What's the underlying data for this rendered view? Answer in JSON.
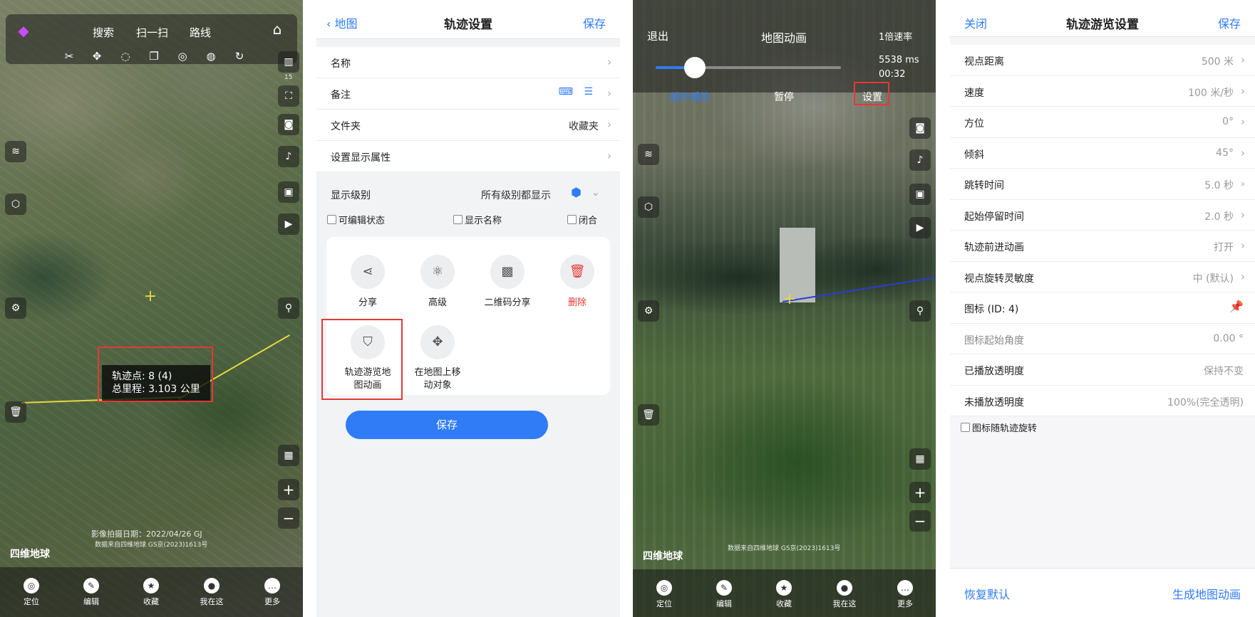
{
  "p1": {
    "top_tabs": [
      "搜索",
      "扫一扫",
      "路线"
    ],
    "level_badge": "15",
    "popup": {
      "line1": "轨迹点: 8 (4)",
      "line2": "总里程: 3.103 公里"
    },
    "capture_date": "影像拍摄日期：2022/04/26 GJ",
    "data_source": "数据来自四维地球 GS京(2023)1613号",
    "logo": "四维地球",
    "bottom_nav": [
      "定位",
      "编辑",
      "收藏",
      "我在这",
      "更多"
    ]
  },
  "p2": {
    "nav": {
      "back": "地图",
      "title": "轨迹设置",
      "save": "保存"
    },
    "rows": [
      {
        "label": "名称",
        "value": ""
      },
      {
        "label": "备注",
        "value": ""
      },
      {
        "label": "文件夹",
        "value": "收藏夹"
      },
      {
        "label": "设置显示属性",
        "value": ""
      }
    ],
    "display_level": {
      "label": "显示级别",
      "value": "所有级别都显示"
    },
    "checkboxes": [
      "可编辑状态",
      "显示名称",
      "闭合"
    ],
    "actions": [
      "分享",
      "高级",
      "二维码分享",
      "删除"
    ],
    "actions2": [
      "轨迹游览地\n图动画",
      "在地图上移\n动对象"
    ],
    "save_button": "保存",
    "colors": {
      "accent": "#2f7cf6",
      "danger": "#e53935"
    }
  },
  "p3": {
    "exit": "退出",
    "title": "地图动画",
    "speed": "1倍速率",
    "duration_ms": "5538 ms",
    "time": "00:32",
    "slider_progress": 0.21,
    "loop": "循环播放",
    "pause": "暂停",
    "settings": "设置",
    "logo": "四维地球",
    "data_source": "数据来自四维地球 GS京(2023)1613号",
    "bottom_nav": [
      "定位",
      "编辑",
      "收藏",
      "我在这",
      "更多"
    ]
  },
  "p4": {
    "nav": {
      "close": "关闭",
      "title": "轨迹游览设置",
      "save": "保存"
    },
    "rows": [
      {
        "label": "视点距离",
        "value": "500 米"
      },
      {
        "label": "速度",
        "value": "100 米/秒"
      },
      {
        "label": "方位",
        "value": "0°"
      },
      {
        "label": "倾斜",
        "value": "45°"
      },
      {
        "label": "跳转时间",
        "value": "5.0 秒"
      },
      {
        "label": "起始停留时间",
        "value": "2.0 秒"
      },
      {
        "label": "轨迹前进动画",
        "value": "打开"
      },
      {
        "label": "视点旋转灵敏度",
        "value": "中 (默认)"
      },
      {
        "label": "图标 (ID: 4)",
        "value": ""
      },
      {
        "label": "图标起始角度",
        "value": "0.00 °"
      },
      {
        "label": "已播放透明度",
        "value": "保持不变"
      },
      {
        "label": "未播放透明度",
        "value": "100%(完全透明)"
      }
    ],
    "checkbox": "图标随轨迹旋转",
    "reset": "恢复默认",
    "generate": "生成地图动画"
  }
}
